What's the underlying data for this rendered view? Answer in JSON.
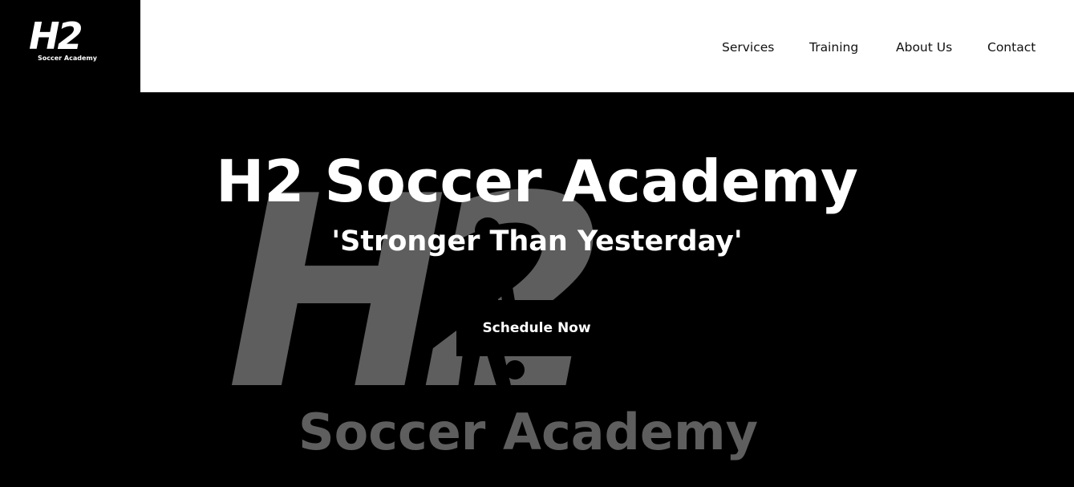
{
  "header": {
    "logo": {
      "mark": "H2",
      "subtitle": "Soccer Academy"
    },
    "nav": [
      {
        "label": "Services"
      },
      {
        "label": "Training"
      },
      {
        "label": "About Us"
      },
      {
        "label": "Contact"
      }
    ]
  },
  "hero": {
    "title": "H2 Soccer Academy",
    "tagline": "'Stronger Than Yesterday'",
    "cta_label": "Schedule Now",
    "watermark": {
      "mark": "H2",
      "subtitle": "Soccer Academy"
    }
  },
  "colors": {
    "background": "#000000",
    "header_bg": "#ffffff",
    "text_light": "#ffffff",
    "text_dark": "#111111",
    "watermark": "#5e5e5e"
  }
}
